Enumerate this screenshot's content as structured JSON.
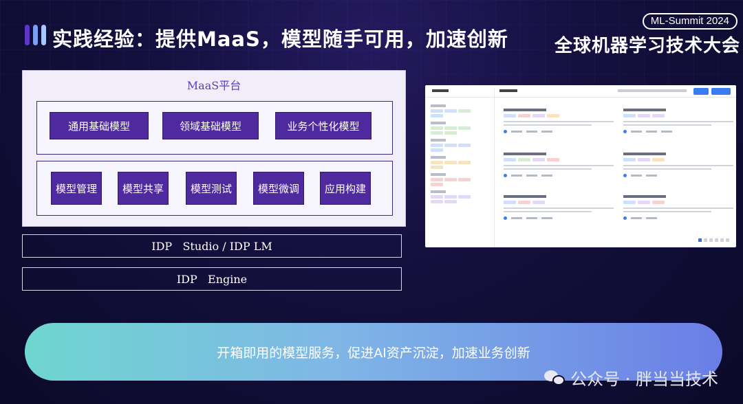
{
  "header": {
    "title": "实践经验：提供MaaS，模型随手可用，加速创新",
    "badge": "ML-Summit 2024",
    "conference": "全球机器学习技术大会"
  },
  "platform": {
    "title": "MaaS平台",
    "models": [
      "通用基础模型",
      "领域基础模型",
      "业务个性化模型"
    ],
    "functions": [
      "模型管理",
      "模型共享",
      "模型测试",
      "模型微调",
      "应用构建"
    ]
  },
  "layers": [
    "IDP   Studio / IDP LM",
    "IDP   Engine"
  ],
  "banner": {
    "text": "开箱即用的模型服务，促进AI资产沉淀，加速业务创新"
  },
  "watermark": {
    "text": "公众号 · 胖当当技术",
    "icon": "wechat-icon"
  },
  "colors": {
    "chip": "#4e2a9e",
    "platform_title": "#5c3db3",
    "banner_start": "#6fd6d0",
    "banner_end": "#6a7ee6"
  }
}
